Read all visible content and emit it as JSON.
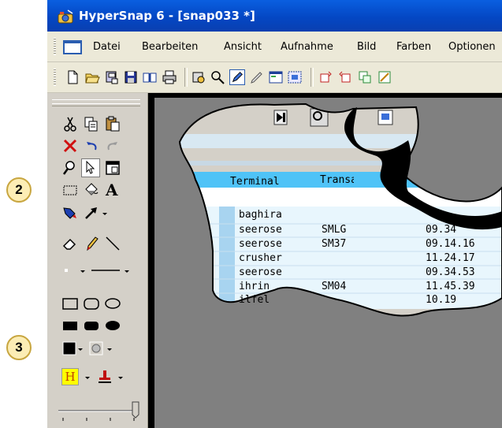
{
  "window": {
    "title": "HyperSnap 6 - [snap033 *]"
  },
  "menu": {
    "items": [
      "Datei",
      "Bearbeiten",
      "Ansicht",
      "Aufnahme",
      "Bild",
      "Farben",
      "Optionen"
    ]
  },
  "callouts": [
    "2",
    "3"
  ],
  "capture": {
    "headers": [
      "Terminal",
      "Transaktion"
    ],
    "rows": [
      {
        "terminal": "baghira",
        "transaktion": "",
        "zeit": ""
      },
      {
        "terminal": "seerose",
        "transaktion": "SMLG",
        "zeit": "09.34"
      },
      {
        "terminal": "seerose",
        "transaktion": "SM37",
        "zeit": "09.14.16"
      },
      {
        "terminal": "crusher",
        "transaktion": "",
        "zeit": "11.24.17"
      },
      {
        "terminal": "seerose",
        "transaktion": "",
        "zeit": "09.34.53"
      },
      {
        "terminal": "ihrin",
        "transaktion": "SM04",
        "zeit": "11.45.39"
      },
      {
        "terminal": "ilfel",
        "transaktion": "",
        "zeit": "10.19"
      }
    ]
  },
  "palette": {
    "text_tool_label": "A",
    "highlight_label": "H"
  },
  "colors": {
    "title_blue": "#0447c4",
    "sap_header": "#4fc3f7",
    "callout_fill": "#fcedb5",
    "canvas_gray": "#808080"
  }
}
